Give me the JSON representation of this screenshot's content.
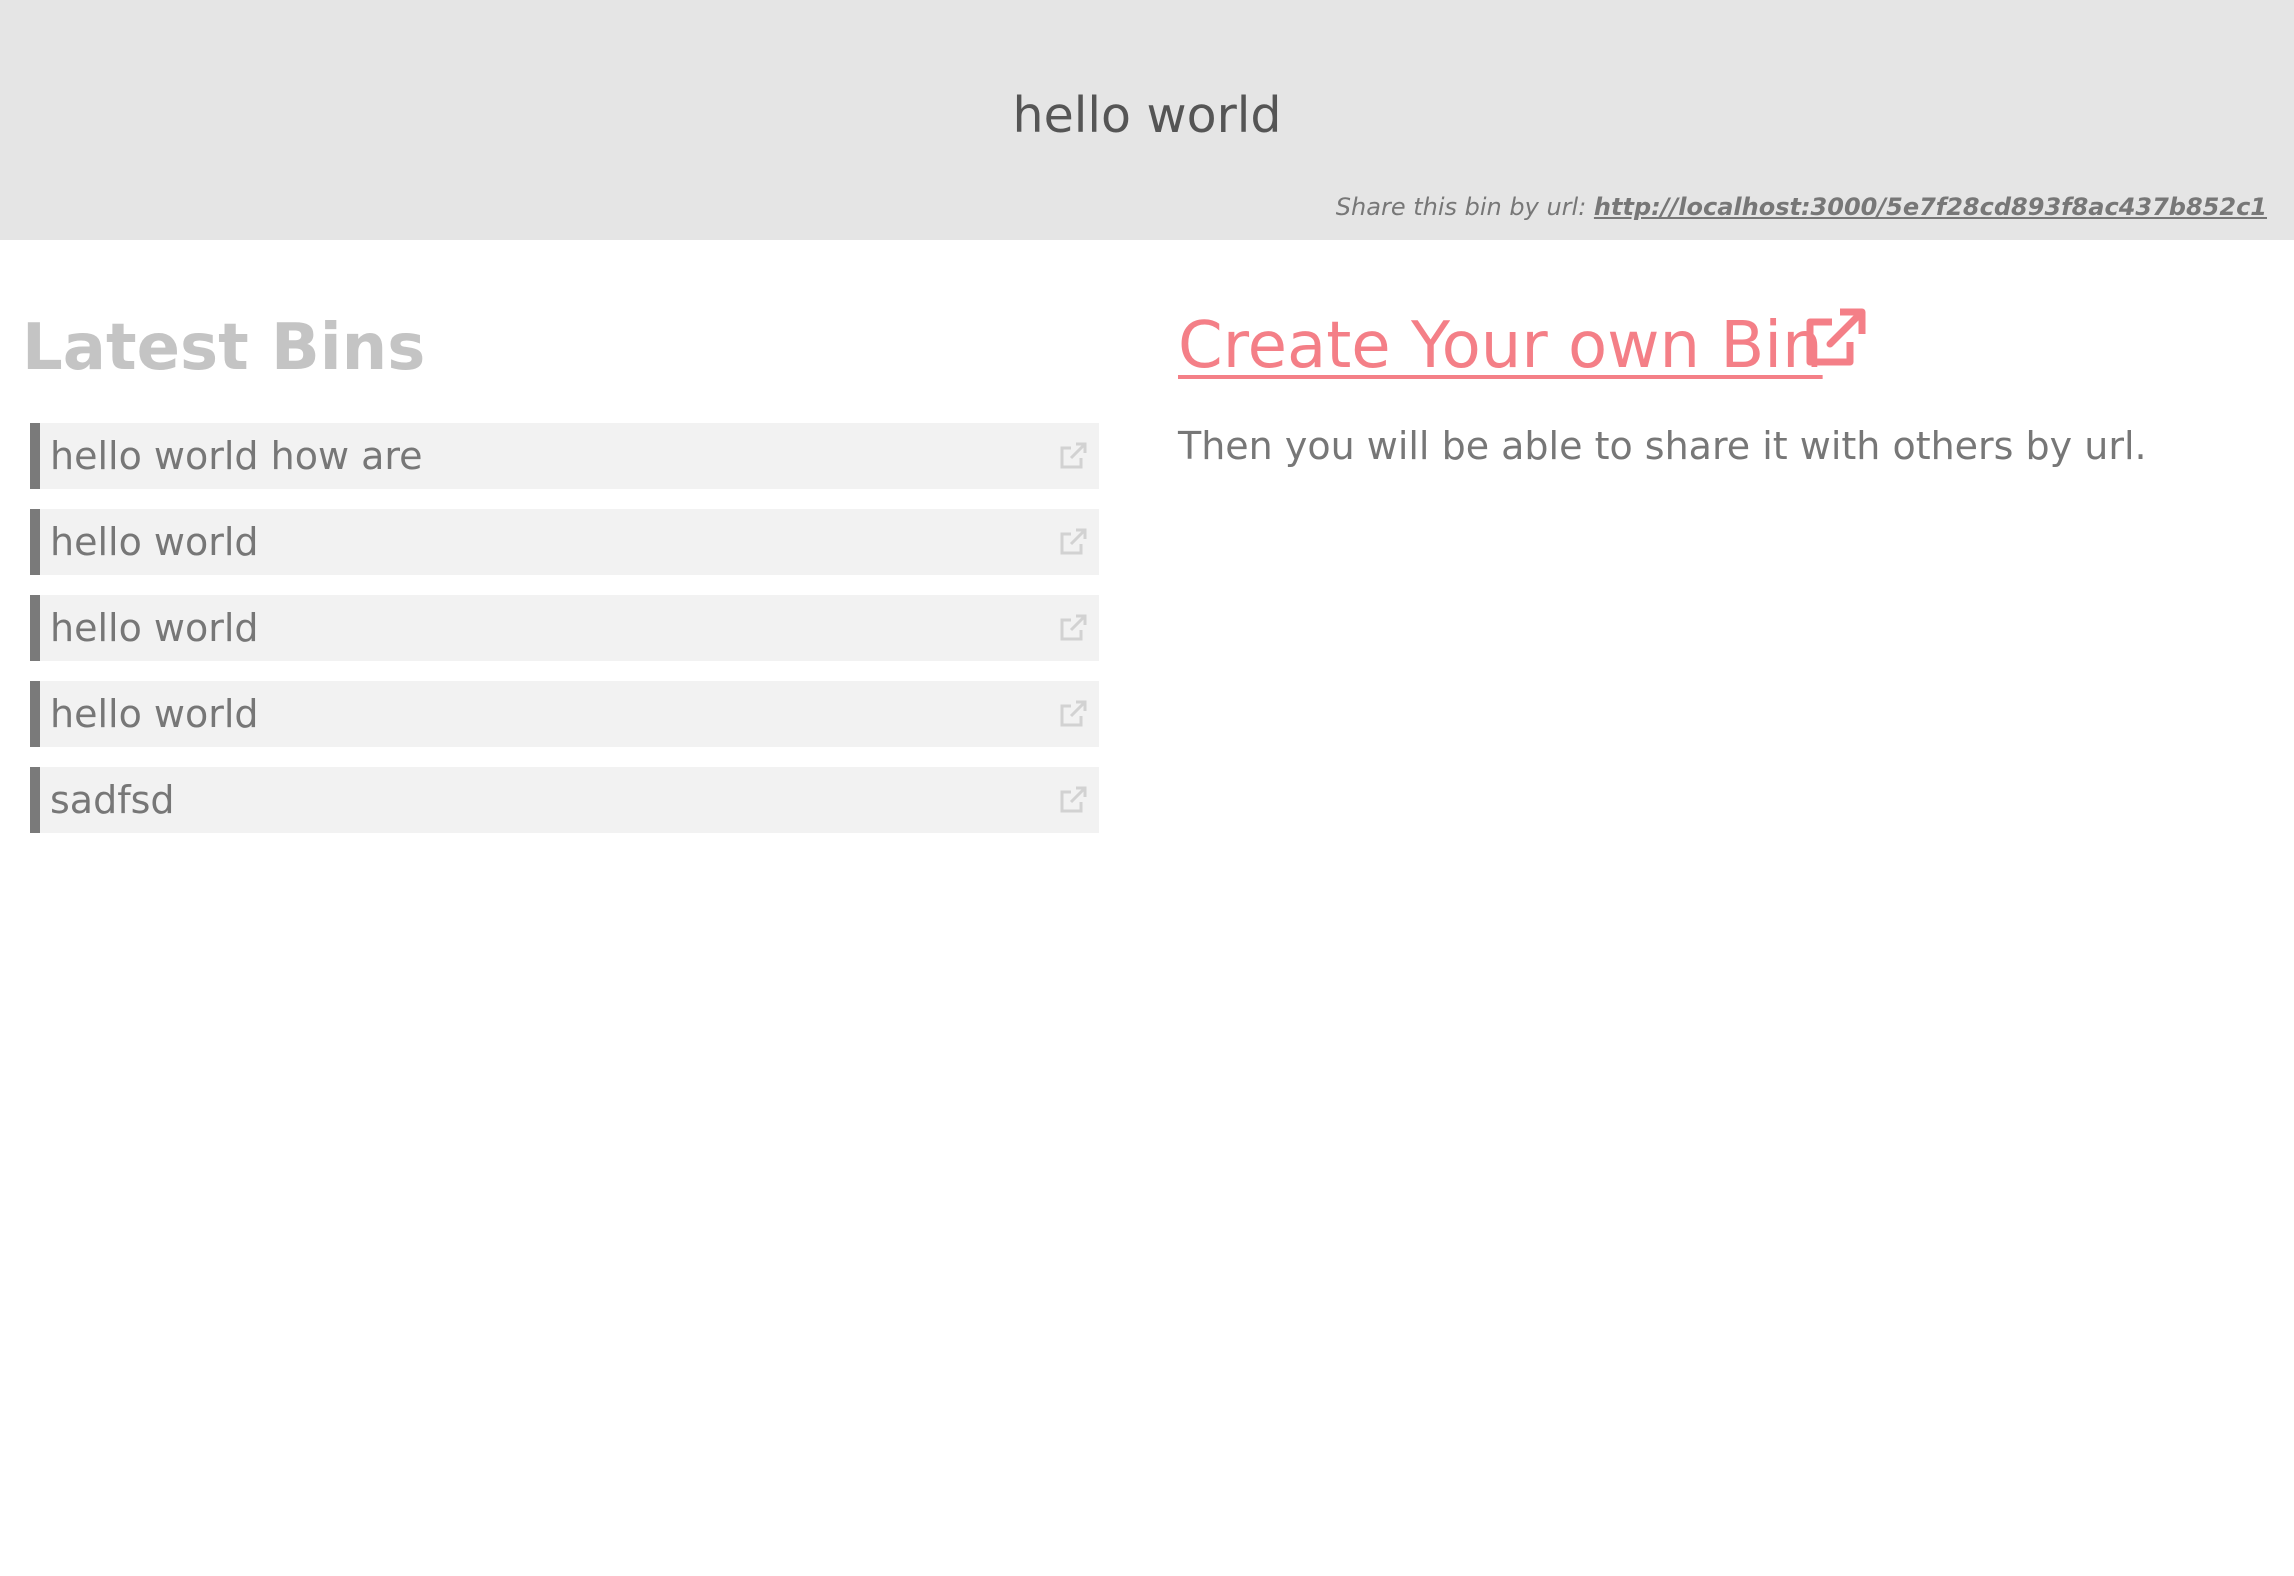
{
  "header": {
    "title": "hello world",
    "share_prefix": "Share this bin by url:",
    "share_url": "http://localhost:3000/5e7f28cd893f8ac437b852c1"
  },
  "latest": {
    "title": "Latest Bins",
    "items": [
      {
        "label": "hello world how are",
        "icon": "external-link-icon"
      },
      {
        "label": "hello world",
        "icon": "external-link-icon"
      },
      {
        "label": "hello world",
        "icon": "external-link-icon"
      },
      {
        "label": "hello world",
        "icon": "external-link-icon"
      },
      {
        "label": "sadfsd",
        "icon": "external-link-icon"
      }
    ]
  },
  "create": {
    "link_label": "Create Your own Bin",
    "icon": "external-link-icon",
    "description": "Then you will be able to share it with others by url."
  },
  "colors": {
    "header_bg": "#e5e5e5",
    "accent": "#f47f87",
    "item_bg": "#f2f2f2",
    "item_border": "#7a7a7a",
    "muted_title": "#c4c4c4",
    "text": "#777777"
  }
}
